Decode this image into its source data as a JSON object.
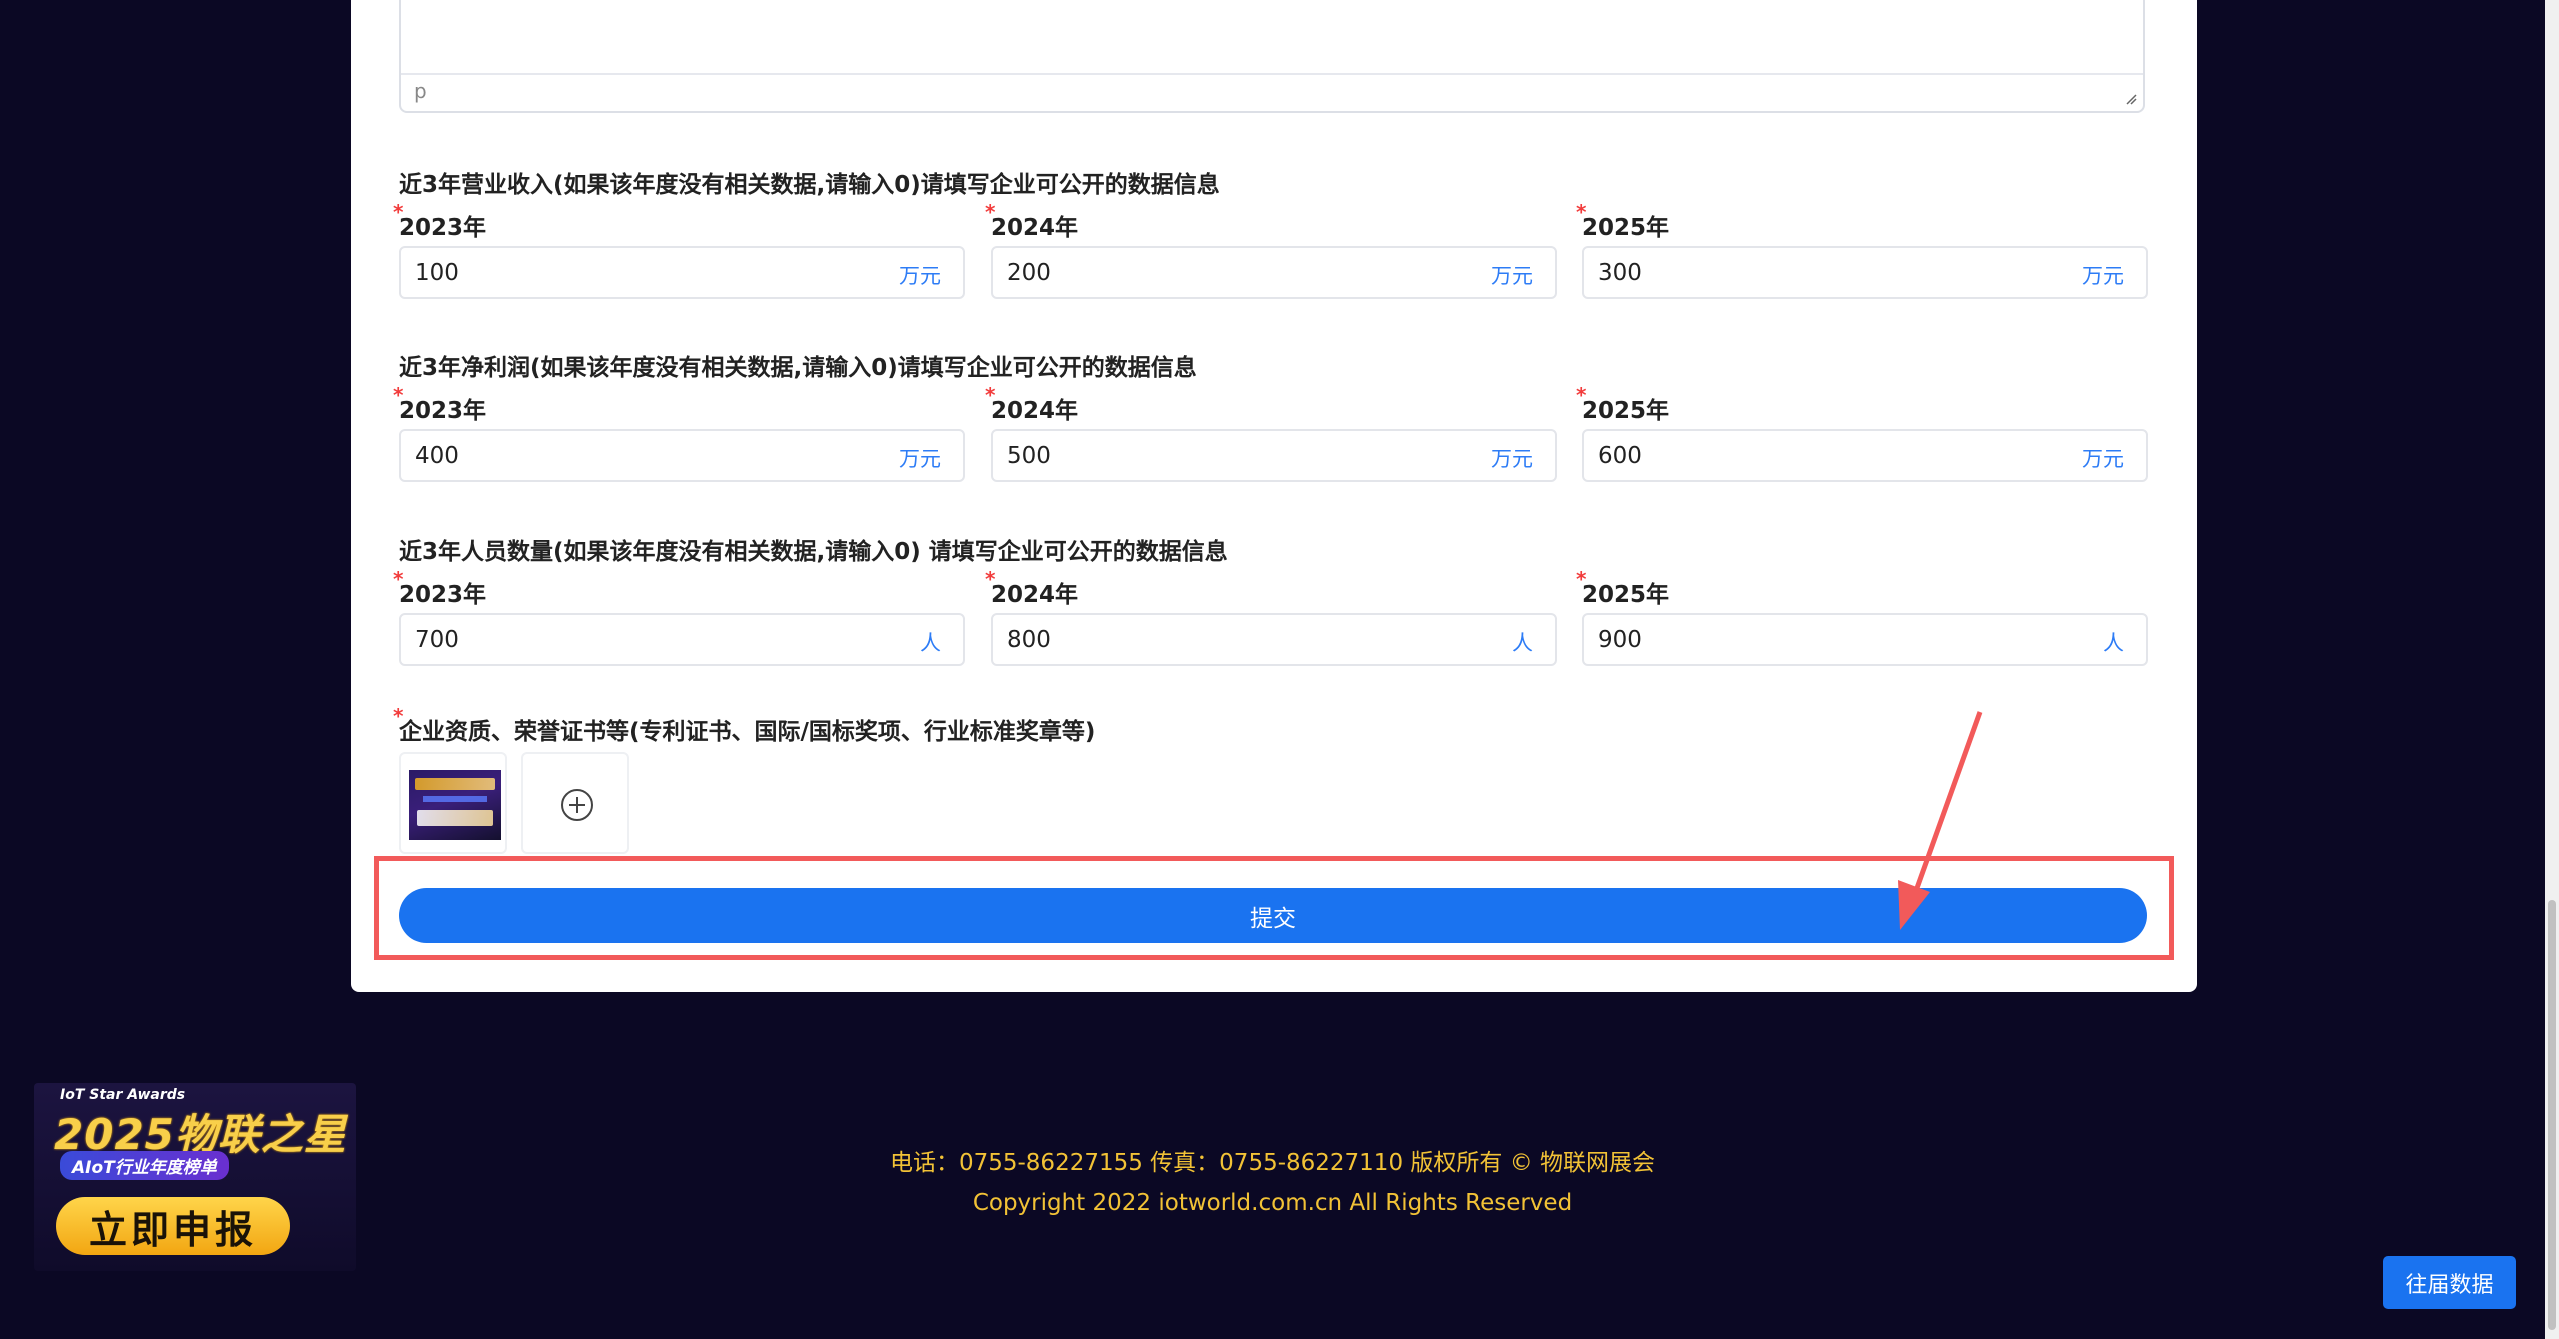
{
  "textarea": {
    "path_label": "p"
  },
  "sections": [
    {
      "title": "近3年营业收入(如果该年度没有相关数据,请输入0)请填写企业可公开的数据信息",
      "fields": [
        {
          "label": "2023年",
          "value": "100",
          "unit": "万元"
        },
        {
          "label": "2024年",
          "value": "200",
          "unit": "万元"
        },
        {
          "label": "2025年",
          "value": "300",
          "unit": "万元"
        }
      ]
    },
    {
      "title": "近3年净利润(如果该年度没有相关数据,请输入0)请填写企业可公开的数据信息",
      "fields": [
        {
          "label": "2023年",
          "value": "400",
          "unit": "万元"
        },
        {
          "label": "2024年",
          "value": "500",
          "unit": "万元"
        },
        {
          "label": "2025年",
          "value": "600",
          "unit": "万元"
        }
      ]
    },
    {
      "title": "近3年人员数量(如果该年度没有相关数据,请输入0) 请填写企业可公开的数据信息",
      "fields": [
        {
          "label": "2023年",
          "value": "700",
          "unit": "人"
        },
        {
          "label": "2024年",
          "value": "800",
          "unit": "人"
        },
        {
          "label": "2025年",
          "value": "900",
          "unit": "人"
        }
      ]
    }
  ],
  "required_mark": "*",
  "certificates": {
    "label": "企业资质、荣誉证书等(专利证书、国际/国标奖项、行业标准奖章等)"
  },
  "submit": {
    "label": "提交"
  },
  "footer": {
    "line1": "电话：0755-86227155 传真：0755-86227110 版权所有 © 物联网展会",
    "line2": "Copyright 2022 iotworld.com.cn All Rights Reserved"
  },
  "promo": {
    "subtitle": "IoT Star Awards",
    "title": "2025物联之星",
    "tag": "AIoT行业年度榜单",
    "cta": "立即申报"
  },
  "history_button": {
    "label": "往届数据"
  },
  "colors": {
    "accent": "#1a73f0",
    "highlight": "#f25a5a",
    "footer_text": "#f2c236",
    "background": "#0b0824"
  }
}
